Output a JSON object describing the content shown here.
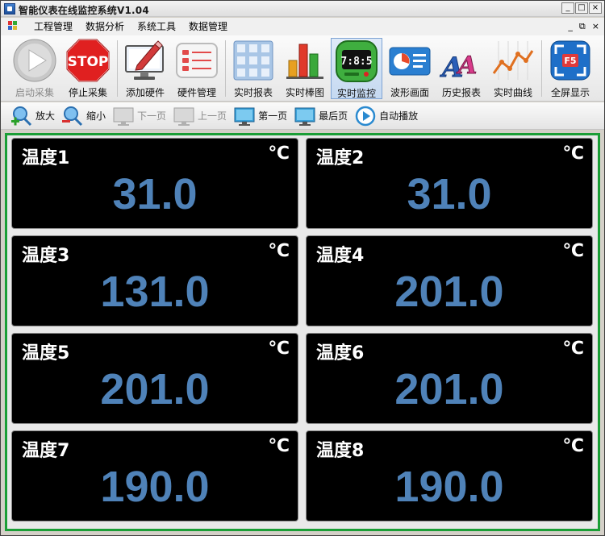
{
  "window": {
    "title": "智能仪表在线监控系统V1.04",
    "controls": {
      "minimize": "_",
      "maximize": "□",
      "close": "×"
    },
    "mdi_controls": {
      "minimize": "_",
      "restore": "⧉",
      "close": "×"
    }
  },
  "menu": [
    "工程管理",
    "数据分析",
    "系统工具",
    "数据管理"
  ],
  "toolbar": {
    "start_capture": "启动采集",
    "stop_capture": "停止采集",
    "stop_icon_text": "STOP",
    "add_hardware": "添加硬件",
    "hardware_manage": "硬件管理",
    "realtime_report": "实时报表",
    "realtime_bar": "实时棒图",
    "realtime_monitor": "实时监控",
    "monitor_icon_text": "7:8:5",
    "waveform": "波形画面",
    "history_report": "历史报表",
    "realtime_curve": "实时曲线",
    "fullscreen": "全屏显示",
    "fullscreen_icon_text": "F5"
  },
  "toolbar2": {
    "zoom_in": "放大",
    "zoom_out": "缩小",
    "next_page": "下一页",
    "prev_page": "上一页",
    "first_page": "第一页",
    "last_page": "最后页",
    "autoplay": "自动播放"
  },
  "tiles": [
    {
      "name": "温度1",
      "unit": "℃",
      "value": "31.0"
    },
    {
      "name": "温度2",
      "unit": "℃",
      "value": "31.0"
    },
    {
      "name": "温度3",
      "unit": "℃",
      "value": "131.0"
    },
    {
      "name": "温度4",
      "unit": "℃",
      "value": "201.0"
    },
    {
      "name": "温度5",
      "unit": "℃",
      "value": "201.0"
    },
    {
      "name": "温度6",
      "unit": "℃",
      "value": "201.0"
    },
    {
      "name": "温度7",
      "unit": "℃",
      "value": "190.0"
    },
    {
      "name": "温度8",
      "unit": "℃",
      "value": "190.0"
    }
  ],
  "colors": {
    "value_text": "#4f82b8",
    "tile_bg": "#000000",
    "monitor_border": "#1b9e36",
    "active_tool_bg": "#c5d9f1"
  }
}
